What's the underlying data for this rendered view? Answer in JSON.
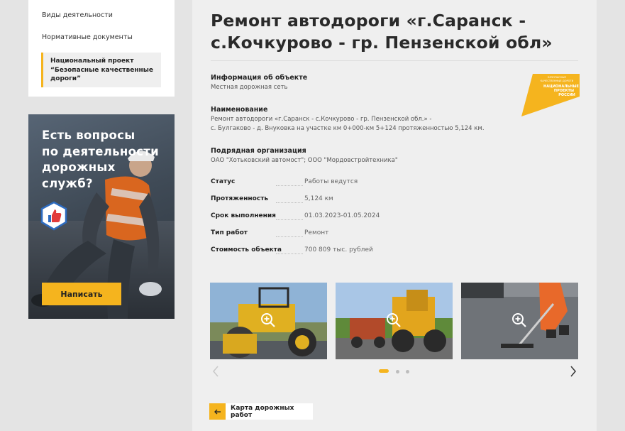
{
  "sidebar": {
    "items": [
      {
        "label": "Виды деятельности"
      },
      {
        "label": "Нормативные документы"
      },
      {
        "label": "Национальный проект\n“Безопасные качественные\nдороги”"
      }
    ]
  },
  "promo": {
    "title": "Есть вопросы\nпо деятельности\nдорожных\nслужб?",
    "button_label": "Написать"
  },
  "object": {
    "title": "Ремонт автодороги «г.Саранск - с.Кочкурово - гр. Пензенской обл»",
    "info_label": "Информация об объекте",
    "info_value": "Местная дорожная сеть",
    "name_label": "Наименование",
    "name_value_1": "Ремонт автодороги «г.Саранск - с.Кочкурово - гр. Пензенской обл.» -",
    "name_value_2": "с. Булгаково - д. Внуковка на участке км 0+000-км 5+124 протяженностью 5,124 км.",
    "contractor_label": "Подрядная организация",
    "contractor_value": "ОАО \"Хотьковский автомост\"; ООО \"Мордовстройтехника\"",
    "details": [
      {
        "key": "Статус",
        "value": "Работы ведутся"
      },
      {
        "key": "Протяженность",
        "value": "5,124 км"
      },
      {
        "key": "Срок выполнения",
        "value": "01.03.2023-01.05.2024"
      },
      {
        "key": "Тип работ",
        "value": "Ремонт"
      },
      {
        "key": "Стоимость объекта",
        "value": "700 809 тыс. рублей"
      }
    ]
  },
  "logo": {
    "line1": "БЕЗОПАСНЫЕ",
    "line2": "КАЧЕСТВЕННЫЕ ДОРОГИ",
    "line3": "НАЦИОНАЛЬНЫЕ",
    "line4": "ПРОЕКТЫ",
    "line5": "РОССИИ"
  },
  "gallery": {
    "icons": [
      "zoom-in-icon",
      "chevron-left-icon",
      "chevron-right-icon"
    ],
    "pagination_active": 1,
    "pagination_total": 3
  },
  "back_link": {
    "label": "Карта дорожных работ"
  },
  "colors": {
    "accent": "#f5b41e",
    "text": "#222222",
    "panel": "#efefef"
  }
}
